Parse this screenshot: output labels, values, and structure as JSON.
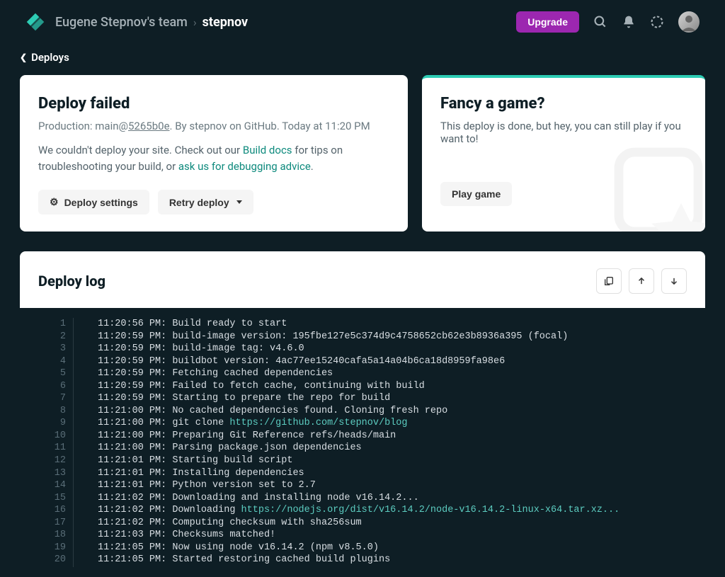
{
  "header": {
    "team_name": "Eugene Stepnov's team",
    "project_name": "stepnov",
    "upgrade_label": "Upgrade"
  },
  "subheader": {
    "back_label": "Deploys"
  },
  "deploy_card": {
    "title": "Deploy failed",
    "meta_prefix": "Production: main@",
    "commit": "5265b0e",
    "meta_suffix": ". By stepnov on GitHub. Today at 11:20 PM",
    "desc_before": "We couldn't deploy your site. Check out our ",
    "docs_link": "Build docs",
    "desc_mid": " for tips on troubleshooting your build, or ",
    "help_link": "ask us for debugging advice",
    "desc_after": ".",
    "settings_label": "Deploy settings",
    "retry_label": "Retry deploy"
  },
  "game_card": {
    "title": "Fancy a game?",
    "text": "This deploy is done, but hey, you can still play if you want to!",
    "play_label": "Play game"
  },
  "log": {
    "title": "Deploy log",
    "lines": [
      {
        "n": 1,
        "ts": "11:20:56 PM",
        "text": "Build ready to start"
      },
      {
        "n": 2,
        "ts": "11:20:59 PM",
        "text": "build-image version: 195fbe127e5c374d9c4758652cb62e3b8936a395 (focal)"
      },
      {
        "n": 3,
        "ts": "11:20:59 PM",
        "text": "build-image tag: v4.6.0"
      },
      {
        "n": 4,
        "ts": "11:20:59 PM",
        "text": "buildbot version: 4ac77ee15240cafa5a14a04b6ca18d8959fa98e6"
      },
      {
        "n": 5,
        "ts": "11:20:59 PM",
        "text": "Fetching cached dependencies"
      },
      {
        "n": 6,
        "ts": "11:20:59 PM",
        "text": "Failed to fetch cache, continuing with build"
      },
      {
        "n": 7,
        "ts": "11:20:59 PM",
        "text": "Starting to prepare the repo for build"
      },
      {
        "n": 8,
        "ts": "11:21:00 PM",
        "text": "No cached dependencies found. Cloning fresh repo"
      },
      {
        "n": 9,
        "ts": "11:21:00 PM",
        "text": "git clone ",
        "link": "https://github.com/stepnov/blog"
      },
      {
        "n": 10,
        "ts": "11:21:00 PM",
        "text": "Preparing Git Reference refs/heads/main"
      },
      {
        "n": 11,
        "ts": "11:21:00 PM",
        "text": "Parsing package.json dependencies"
      },
      {
        "n": 12,
        "ts": "11:21:01 PM",
        "text": "Starting build script"
      },
      {
        "n": 13,
        "ts": "11:21:01 PM",
        "text": "Installing dependencies"
      },
      {
        "n": 14,
        "ts": "11:21:01 PM",
        "text": "Python version set to 2.7"
      },
      {
        "n": 15,
        "ts": "11:21:02 PM",
        "text": "Downloading and installing node v16.14.2..."
      },
      {
        "n": 16,
        "ts": "11:21:02 PM",
        "text": "Downloading ",
        "link": "https://nodejs.org/dist/v16.14.2/node-v16.14.2-linux-x64.tar.xz..."
      },
      {
        "n": 17,
        "ts": "11:21:02 PM",
        "text": "Computing checksum with sha256sum"
      },
      {
        "n": 18,
        "ts": "11:21:03 PM",
        "text": "Checksums matched!"
      },
      {
        "n": 19,
        "ts": "11:21:05 PM",
        "text": "Now using node v16.14.2 (npm v8.5.0)"
      },
      {
        "n": 20,
        "ts": "11:21:05 PM",
        "text": "Started restoring cached build plugins"
      }
    ]
  }
}
